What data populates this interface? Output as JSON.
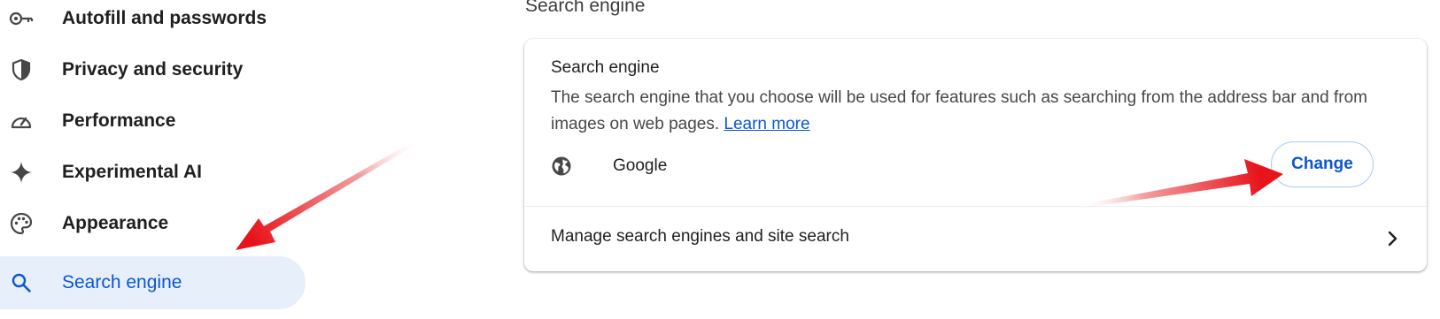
{
  "sidebar": {
    "items": [
      {
        "label": "Autofill and passwords",
        "icon": "key-icon"
      },
      {
        "label": "Privacy and security",
        "icon": "shield-icon"
      },
      {
        "label": "Performance",
        "icon": "speedometer-icon"
      },
      {
        "label": "Experimental AI",
        "icon": "sparkle-icon"
      },
      {
        "label": "Appearance",
        "icon": "palette-icon"
      },
      {
        "label": "Search engine",
        "icon": "search-icon",
        "active": true
      }
    ]
  },
  "main": {
    "section_title": "Search engine",
    "card": {
      "title": "Search engine",
      "description": "The search engine that you choose will be used for features such as searching from the address bar and from images on web pages.",
      "learn_more": "Learn more",
      "current_engine": "Google",
      "change_label": "Change",
      "manage_label": "Manage search engines and site search"
    }
  },
  "colors": {
    "accent": "#0b57d0",
    "active_bg": "#e7effb",
    "annotation_arrow": "#e8141b"
  }
}
